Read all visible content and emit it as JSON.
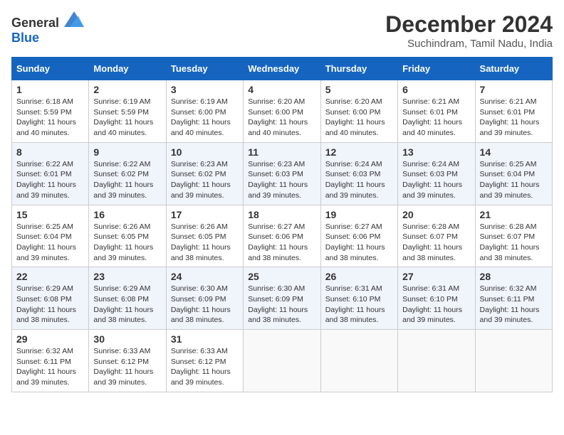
{
  "header": {
    "logo_general": "General",
    "logo_blue": "Blue",
    "title": "December 2024",
    "subtitle": "Suchindram, Tamil Nadu, India"
  },
  "calendar": {
    "days_of_week": [
      "Sunday",
      "Monday",
      "Tuesday",
      "Wednesday",
      "Thursday",
      "Friday",
      "Saturday"
    ],
    "weeks": [
      [
        null,
        null,
        null,
        null,
        null,
        null,
        null
      ]
    ],
    "cells": [
      {
        "day": null,
        "info": null
      },
      {
        "day": null,
        "info": null
      },
      {
        "day": null,
        "info": null
      },
      {
        "day": null,
        "info": null
      },
      {
        "day": null,
        "info": null
      },
      {
        "day": null,
        "info": null
      },
      {
        "day": null,
        "info": null
      }
    ]
  },
  "days": {
    "week1": [
      {
        "num": "1",
        "sunrise": "6:18 AM",
        "sunset": "5:59 PM",
        "daylight": "11 hours and 40 minutes."
      },
      {
        "num": "2",
        "sunrise": "6:19 AM",
        "sunset": "5:59 PM",
        "daylight": "11 hours and 40 minutes."
      },
      {
        "num": "3",
        "sunrise": "6:19 AM",
        "sunset": "6:00 PM",
        "daylight": "11 hours and 40 minutes."
      },
      {
        "num": "4",
        "sunrise": "6:20 AM",
        "sunset": "6:00 PM",
        "daylight": "11 hours and 40 minutes."
      },
      {
        "num": "5",
        "sunrise": "6:20 AM",
        "sunset": "6:00 PM",
        "daylight": "11 hours and 40 minutes."
      },
      {
        "num": "6",
        "sunrise": "6:21 AM",
        "sunset": "6:01 PM",
        "daylight": "11 hours and 40 minutes."
      },
      {
        "num": "7",
        "sunrise": "6:21 AM",
        "sunset": "6:01 PM",
        "daylight": "11 hours and 39 minutes."
      }
    ],
    "week2": [
      {
        "num": "8",
        "sunrise": "6:22 AM",
        "sunset": "6:01 PM",
        "daylight": "11 hours and 39 minutes."
      },
      {
        "num": "9",
        "sunrise": "6:22 AM",
        "sunset": "6:02 PM",
        "daylight": "11 hours and 39 minutes."
      },
      {
        "num": "10",
        "sunrise": "6:23 AM",
        "sunset": "6:02 PM",
        "daylight": "11 hours and 39 minutes."
      },
      {
        "num": "11",
        "sunrise": "6:23 AM",
        "sunset": "6:03 PM",
        "daylight": "11 hours and 39 minutes."
      },
      {
        "num": "12",
        "sunrise": "6:24 AM",
        "sunset": "6:03 PM",
        "daylight": "11 hours and 39 minutes."
      },
      {
        "num": "13",
        "sunrise": "6:24 AM",
        "sunset": "6:03 PM",
        "daylight": "11 hours and 39 minutes."
      },
      {
        "num": "14",
        "sunrise": "6:25 AM",
        "sunset": "6:04 PM",
        "daylight": "11 hours and 39 minutes."
      }
    ],
    "week3": [
      {
        "num": "15",
        "sunrise": "6:25 AM",
        "sunset": "6:04 PM",
        "daylight": "11 hours and 39 minutes."
      },
      {
        "num": "16",
        "sunrise": "6:26 AM",
        "sunset": "6:05 PM",
        "daylight": "11 hours and 39 minutes."
      },
      {
        "num": "17",
        "sunrise": "6:26 AM",
        "sunset": "6:05 PM",
        "daylight": "11 hours and 38 minutes."
      },
      {
        "num": "18",
        "sunrise": "6:27 AM",
        "sunset": "6:06 PM",
        "daylight": "11 hours and 38 minutes."
      },
      {
        "num": "19",
        "sunrise": "6:27 AM",
        "sunset": "6:06 PM",
        "daylight": "11 hours and 38 minutes."
      },
      {
        "num": "20",
        "sunrise": "6:28 AM",
        "sunset": "6:07 PM",
        "daylight": "11 hours and 38 minutes."
      },
      {
        "num": "21",
        "sunrise": "6:28 AM",
        "sunset": "6:07 PM",
        "daylight": "11 hours and 38 minutes."
      }
    ],
    "week4": [
      {
        "num": "22",
        "sunrise": "6:29 AM",
        "sunset": "6:08 PM",
        "daylight": "11 hours and 38 minutes."
      },
      {
        "num": "23",
        "sunrise": "6:29 AM",
        "sunset": "6:08 PM",
        "daylight": "11 hours and 38 minutes."
      },
      {
        "num": "24",
        "sunrise": "6:30 AM",
        "sunset": "6:09 PM",
        "daylight": "11 hours and 38 minutes."
      },
      {
        "num": "25",
        "sunrise": "6:30 AM",
        "sunset": "6:09 PM",
        "daylight": "11 hours and 38 minutes."
      },
      {
        "num": "26",
        "sunrise": "6:31 AM",
        "sunset": "6:10 PM",
        "daylight": "11 hours and 38 minutes."
      },
      {
        "num": "27",
        "sunrise": "6:31 AM",
        "sunset": "6:10 PM",
        "daylight": "11 hours and 39 minutes."
      },
      {
        "num": "28",
        "sunrise": "6:32 AM",
        "sunset": "6:11 PM",
        "daylight": "11 hours and 39 minutes."
      }
    ],
    "week5": [
      {
        "num": "29",
        "sunrise": "6:32 AM",
        "sunset": "6:11 PM",
        "daylight": "11 hours and 39 minutes."
      },
      {
        "num": "30",
        "sunrise": "6:33 AM",
        "sunset": "6:12 PM",
        "daylight": "11 hours and 39 minutes."
      },
      {
        "num": "31",
        "sunrise": "6:33 AM",
        "sunset": "6:12 PM",
        "daylight": "11 hours and 39 minutes."
      },
      null,
      null,
      null,
      null
    ]
  },
  "labels": {
    "sunrise": "Sunrise:",
    "sunset": "Sunset:",
    "daylight": "Daylight:"
  }
}
